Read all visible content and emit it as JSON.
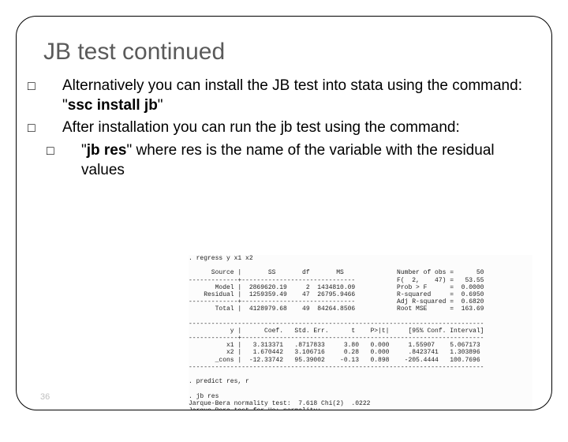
{
  "title": "JB test continued",
  "bullet1_a": "Alternatively you can install the JB test into stata using the command: \"",
  "bullet1_b": "ssc install jb",
  "bullet1_c": "\"",
  "bullet2": "After installation you can run the jb test using the command:",
  "sub_a": "\"",
  "sub_b": "jb res",
  "sub_c": "\" where res is the name of the variable with the residual values",
  "stata": ". regress y x1 x2\n\n      Source |       SS       df       MS              Number of obs =      50\n-------------+------------------------------           F(  2,    47) =   53.55\n       Model |  2869620.19     2  1434810.09           Prob > F      =  0.0000\n    Residual |  1259359.49    47  26795.9466           R-squared     =  0.6950\n-------------+------------------------------           Adj R-squared =  0.6820\n       Total |  4128979.68    49  84264.8506           Root MSE      =  163.69\n\n------------------------------------------------------------------------------\n           y |      Coef.   Std. Err.      t    P>|t|     [95% Conf. Interval]\n-------------+----------------------------------------------------------------\n          x1 |   3.313371   .8717833     3.80   0.000     1.55907    5.067173\n          x2 |   1.670442   3.106716     0.28   0.000     .8423741   1.303896\n       _cons |  -12.33742   95.39002    -0.13   0.898    -205.4444   100.7696\n------------------------------------------------------------------------------\n\n. predict res, r\n\n. jb res\nJarque-Bera normality test:  7.618 Chi(2)  .0222\nJarque-Bera test for Ho: normality:",
  "pagenum": "36"
}
